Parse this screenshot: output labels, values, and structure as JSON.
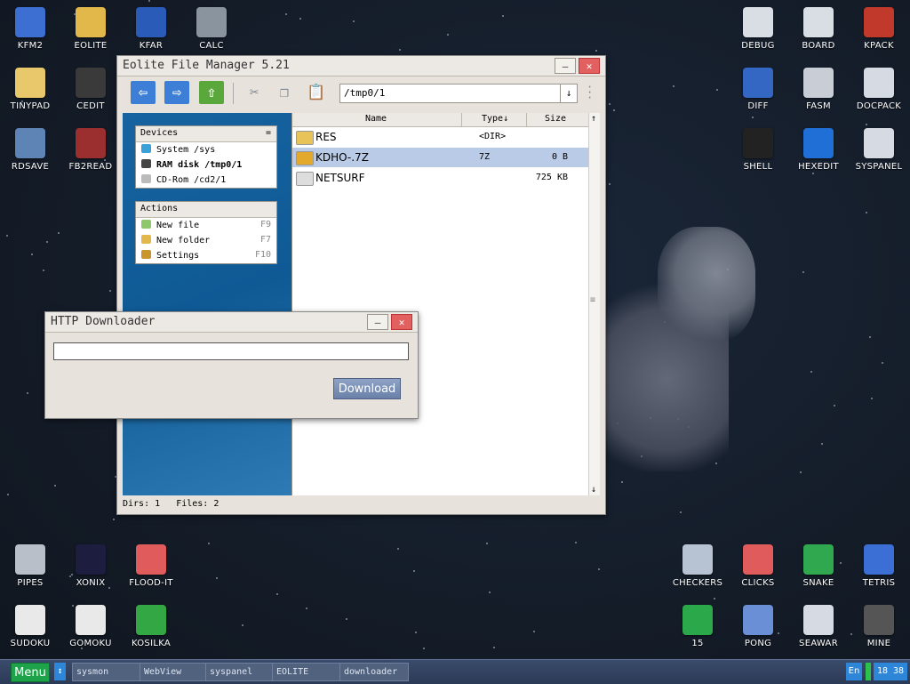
{
  "desktop": {
    "icons_left_top": [
      {
        "label": "KFM2",
        "icon": "floppy-icon",
        "color": "#3c6fd1"
      },
      {
        "label": "EOLITE",
        "icon": "folder-icon",
        "color": "#e2b84b"
      },
      {
        "label": "KFAR",
        "icon": "file-manager-icon",
        "color": "#2b5bb8"
      },
      {
        "label": "CALC",
        "icon": "calculator-icon",
        "color": "#8a949e"
      },
      {
        "label": "TINYPAD",
        "icon": "notepad-icon",
        "color": "#e8c86a"
      },
      {
        "label": "CEDIT",
        "icon": "code-icon",
        "color": "#3a3a3a"
      },
      {
        "label": "RDSAVE",
        "icon": "save-icon",
        "color": "#5d84b5"
      },
      {
        "label": "FB2READ",
        "icon": "book-icon",
        "color": "#9b2f2f"
      }
    ],
    "icons_right_top": [
      {
        "label": "DEBUG",
        "icon": "debug-icon",
        "color": "#d9dde4"
      },
      {
        "label": "BOARD",
        "icon": "board-icon",
        "color": "#d9dde4"
      },
      {
        "label": "KPACK",
        "icon": "hammer-icon",
        "color": "#c0392b"
      },
      {
        "label": "DIFF",
        "icon": "diff-icon",
        "color": "#3466c4"
      },
      {
        "label": "FASM",
        "icon": "fasm-icon",
        "color": "#c9ced6"
      },
      {
        "label": "DOCPACK",
        "icon": "cabinet-icon",
        "color": "#d6dbe3"
      },
      {
        "label": "SHELL",
        "icon": "terminal-icon",
        "color": "#222"
      },
      {
        "label": "HEXEDIT",
        "icon": "hex-icon",
        "color": "#1f6fd6"
      },
      {
        "label": "SYSPANEL",
        "icon": "sliders-icon",
        "color": "#d6dbe3"
      }
    ],
    "icons_left_bottom": [
      {
        "label": "PIPES",
        "icon": "pipes-icon",
        "color": "#b9bfc8"
      },
      {
        "label": "XONIX",
        "icon": "xonix-icon",
        "color": "#1d1d40"
      },
      {
        "label": "FLOOD-IT",
        "icon": "flood-icon",
        "color": "#e05b5b"
      },
      {
        "label": "SUDOKU",
        "icon": "sudoku-icon",
        "color": "#e9e9e9"
      },
      {
        "label": "GOMOKU",
        "icon": "gomoku-icon",
        "color": "#e9e9e9"
      },
      {
        "label": "KOSILKA",
        "icon": "mower-icon",
        "color": "#33a744"
      }
    ],
    "icons_right_bottom": [
      {
        "label": "CHECKERS",
        "icon": "checkers-icon",
        "color": "#b7c2d3"
      },
      {
        "label": "CLICKS",
        "icon": "clicks-icon",
        "color": "#e05b5b"
      },
      {
        "label": "SNAKE",
        "icon": "snake-icon",
        "color": "#2fa84f"
      },
      {
        "label": "TETRIS",
        "icon": "tetris-icon",
        "color": "#3b6fd6"
      },
      {
        "label": "15",
        "icon": "fifteen-icon",
        "color": "#2aa84a"
      },
      {
        "label": "PONG",
        "icon": "pong-icon",
        "color": "#6b8fd6"
      },
      {
        "label": "SEAWAR",
        "icon": "ship-icon",
        "color": "#d6dbe3"
      },
      {
        "label": "MINE",
        "icon": "mine-icon",
        "color": "#555"
      }
    ]
  },
  "file_manager": {
    "title": "Eolite File Manager 5.21",
    "path": "/tmp0/1",
    "path_dropdown": "↓",
    "devices": {
      "header": "Devices",
      "header_mark": "=",
      "items": [
        {
          "label": "System /sys",
          "icon": "system-icon",
          "color": "#3aa0d8"
        },
        {
          "label": "RAM disk /tmp0/1",
          "icon": "ram-icon",
          "color": "#444",
          "bold": true
        },
        {
          "label": "CD-Rom /cd2/1",
          "icon": "cd-icon",
          "color": "#bbb"
        }
      ]
    },
    "actions": {
      "header": "Actions",
      "items": [
        {
          "label": "New file",
          "key": "F9",
          "icon": "new-file-icon",
          "color": "#8dc96c"
        },
        {
          "label": "New folder",
          "key": "F7",
          "icon": "new-folder-icon",
          "color": "#e2b84b"
        },
        {
          "label": "Settings",
          "key": "F10",
          "icon": "settings-icon",
          "color": "#c9962e"
        }
      ]
    },
    "columns": {
      "name": "Name",
      "type": "Type↓",
      "size": "Size",
      "scroll_up": "↑",
      "scroll_down": "↓",
      "scroll_grip": "≡"
    },
    "files": [
      {
        "name": "RES",
        "type": "<DIR>",
        "size": "",
        "icon": "folder-icon",
        "color": "#e8c35a"
      },
      {
        "name": "KDHO-.7Z",
        "type": "7Z",
        "size": "0 B",
        "icon": "archive-icon",
        "color": "#e3a92d",
        "selected": true
      },
      {
        "name": "NETSURF",
        "type": "",
        "size": "725 KB",
        "icon": "binary-icon",
        "color": "#ddd"
      }
    ],
    "status": "Dirs: 1   Files: 2"
  },
  "downloader": {
    "title": "HTTP Downloader",
    "url_value": "",
    "button": "Download"
  },
  "taskbar": {
    "menu": "Menu",
    "switch": "↕",
    "tasks": [
      "sysmon",
      "WebView",
      "syspanel",
      "EOLITE",
      "downloader"
    ],
    "lang": "En",
    "clock": "18 38"
  }
}
